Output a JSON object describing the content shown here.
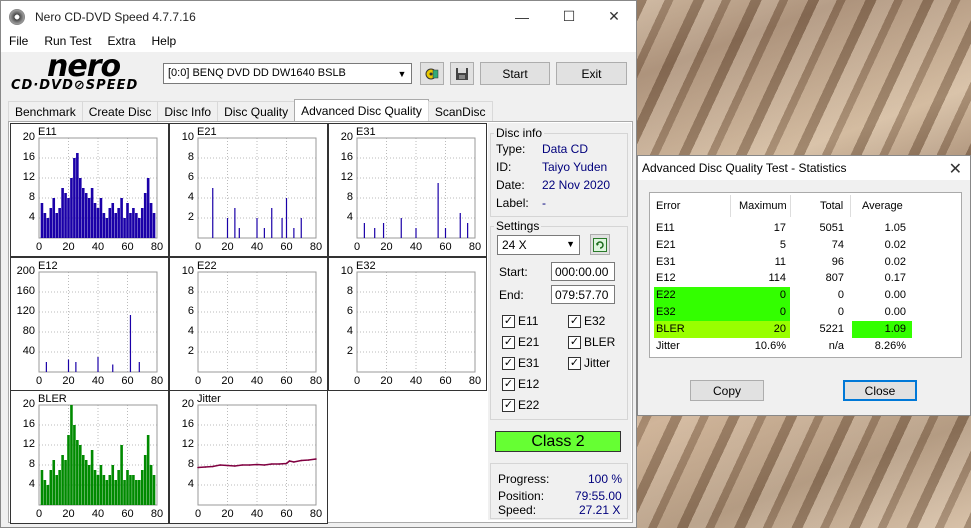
{
  "window": {
    "title": "Nero CD-DVD Speed 4.7.7.16",
    "controls": {
      "minimize": "—",
      "maximize": "☐",
      "close": "✕"
    },
    "menu": [
      "File",
      "Run Test",
      "Extra",
      "Help"
    ],
    "logo": {
      "line1": "nero",
      "line2": "CD·DVD⊘SPEED"
    },
    "drive": "[0:0]   BENQ DVD DD DW1640 BSLB",
    "start_label": "Start",
    "exit_label": "Exit",
    "tabs": [
      "Benchmark",
      "Create Disc",
      "Disc Info",
      "Disc Quality",
      "Advanced Disc Quality",
      "ScanDisc"
    ],
    "active_tab": "Advanced Disc Quality"
  },
  "disc_info": {
    "legend": "Disc info",
    "type_label": "Type:",
    "type": "Data CD",
    "id_label": "ID:",
    "id": "Taiyo Yuden",
    "date_label": "Date:",
    "date": "22 Nov 2020",
    "label_label": "Label:",
    "label": "-"
  },
  "settings": {
    "legend": "Settings",
    "speed": "24 X",
    "start_label": "Start:",
    "start": "000:00.00",
    "end_label": "End:",
    "end": "079:57.70",
    "checks": [
      {
        "label": "E11",
        "checked": true
      },
      {
        "label": "E32",
        "checked": true
      },
      {
        "label": "E21",
        "checked": true
      },
      {
        "label": "BLER",
        "checked": true
      },
      {
        "label": "E31",
        "checked": true
      },
      {
        "label": "Jitter",
        "checked": true
      },
      {
        "label": "E12",
        "checked": true
      },
      {
        "label": "E22",
        "checked": true
      }
    ]
  },
  "class_badge": "Class 2",
  "progress": {
    "progress_label": "Progress:",
    "progress": "100 %",
    "position_label": "Position:",
    "position": "79:55.00",
    "speed_label": "Speed:",
    "speed": "27.21 X"
  },
  "stats_dialog": {
    "title": "Advanced Disc Quality Test - Statistics",
    "headers": [
      "Error",
      "Maximum",
      "Total",
      "Average"
    ],
    "rows": [
      [
        "E11",
        "17",
        "5051",
        "1.05"
      ],
      [
        "E21",
        "5",
        "74",
        "0.02"
      ],
      [
        "E31",
        "11",
        "96",
        "0.02"
      ],
      [
        "E12",
        "114",
        "807",
        "0.17"
      ],
      [
        "E22",
        "0",
        "0",
        "0.00"
      ],
      [
        "E32",
        "0",
        "0",
        "0.00"
      ],
      [
        "BLER",
        "20",
        "5221",
        "1.09"
      ],
      [
        "Jitter",
        "10.6%",
        "n/a",
        "8.26%"
      ]
    ],
    "copy_label": "Copy",
    "close_label": "Close"
  },
  "colors": {
    "bar": "#1a00a8",
    "bler": "#008a00",
    "jitter": "#800040",
    "highlight_green": "#33ff00",
    "highlight_lime": "#99ff00",
    "class_green": "#66ff33"
  },
  "chart_data": [
    {
      "type": "bar",
      "title": "E11",
      "ylim": [
        0,
        20
      ],
      "yticks": [
        4,
        8,
        12,
        16,
        20
      ],
      "xticks": [
        0,
        20,
        40,
        60,
        80
      ],
      "x": [
        2,
        4,
        6,
        8,
        10,
        12,
        14,
        16,
        18,
        20,
        22,
        24,
        26,
        28,
        30,
        32,
        34,
        36,
        38,
        40,
        42,
        44,
        46,
        48,
        50,
        52,
        54,
        56,
        58,
        60,
        62,
        64,
        66,
        68,
        70,
        72,
        74,
        76,
        78
      ],
      "values": [
        7,
        5,
        4,
        6,
        8,
        5,
        6,
        10,
        9,
        8,
        12,
        16,
        17,
        12,
        10,
        9,
        8,
        10,
        7,
        6,
        8,
        5,
        4,
        6,
        7,
        5,
        6,
        8,
        4,
        7,
        5,
        6,
        5,
        4,
        6,
        9,
        12,
        7,
        5
      ]
    },
    {
      "type": "bar",
      "title": "E21",
      "ylim": [
        0,
        10
      ],
      "yticks": [
        2,
        4,
        6,
        8,
        10
      ],
      "xticks": [
        0,
        20,
        40,
        60,
        80
      ],
      "x": [
        10,
        20,
        25,
        28,
        40,
        45,
        50,
        57,
        60,
        65,
        70
      ],
      "values": [
        5,
        2,
        3,
        1,
        2,
        1,
        3,
        2,
        4,
        1,
        2
      ]
    },
    {
      "type": "bar",
      "title": "E31",
      "ylim": [
        0,
        20
      ],
      "yticks": [
        4,
        8,
        12,
        16,
        20
      ],
      "xticks": [
        0,
        20,
        40,
        60,
        80
      ],
      "x": [
        5,
        12,
        18,
        30,
        40,
        55,
        60,
        70,
        75
      ],
      "values": [
        3,
        2,
        3,
        4,
        2,
        11,
        2,
        5,
        3
      ]
    },
    {
      "type": "bar",
      "title": "E12",
      "ylim": [
        0,
        200
      ],
      "yticks": [
        40,
        80,
        120,
        160,
        200
      ],
      "xticks": [
        0,
        20,
        40,
        60,
        80
      ],
      "x": [
        5,
        20,
        25,
        40,
        50,
        62,
        68
      ],
      "values": [
        20,
        25,
        20,
        30,
        15,
        114,
        20
      ]
    },
    {
      "type": "bar",
      "title": "E22",
      "ylim": [
        0,
        10
      ],
      "yticks": [
        2,
        4,
        6,
        8,
        10
      ],
      "xticks": [
        0,
        20,
        40,
        60,
        80
      ],
      "x": [],
      "values": []
    },
    {
      "type": "bar",
      "title": "E32",
      "ylim": [
        0,
        10
      ],
      "yticks": [
        2,
        4,
        6,
        8,
        10
      ],
      "xticks": [
        0,
        20,
        40,
        60,
        80
      ],
      "x": [],
      "values": []
    },
    {
      "type": "bar",
      "title": "BLER",
      "ylim": [
        0,
        20
      ],
      "yticks": [
        4,
        8,
        12,
        16,
        20
      ],
      "xticks": [
        0,
        20,
        40,
        60,
        80
      ],
      "x": [
        2,
        4,
        6,
        8,
        10,
        12,
        14,
        16,
        18,
        20,
        22,
        24,
        26,
        28,
        30,
        32,
        34,
        36,
        38,
        40,
        42,
        44,
        46,
        48,
        50,
        52,
        54,
        56,
        58,
        60,
        62,
        64,
        66,
        68,
        70,
        72,
        74,
        76,
        78
      ],
      "values": [
        7,
        5,
        4,
        7,
        9,
        6,
        7,
        10,
        9,
        14,
        20,
        16,
        13,
        12,
        10,
        9,
        8,
        11,
        7,
        6,
        8,
        6,
        5,
        6,
        8,
        5,
        7,
        12,
        5,
        7,
        6,
        6,
        5,
        5,
        7,
        10,
        14,
        8,
        6
      ]
    },
    {
      "type": "line",
      "title": "Jitter",
      "ylim": [
        0,
        20
      ],
      "yticks": [
        4,
        8,
        12,
        16,
        20
      ],
      "xticks": [
        0,
        20,
        40,
        60,
        80
      ],
      "x": [
        0,
        5,
        10,
        15,
        20,
        25,
        30,
        35,
        40,
        45,
        50,
        55,
        60,
        62,
        65,
        70,
        75,
        80
      ],
      "values": [
        7.5,
        7.6,
        7.7,
        8.0,
        7.9,
        7.8,
        8.0,
        8.0,
        8.1,
        8.0,
        8.2,
        8.2,
        8.3,
        8.8,
        8.6,
        8.9,
        9.0,
        9.2
      ]
    }
  ]
}
